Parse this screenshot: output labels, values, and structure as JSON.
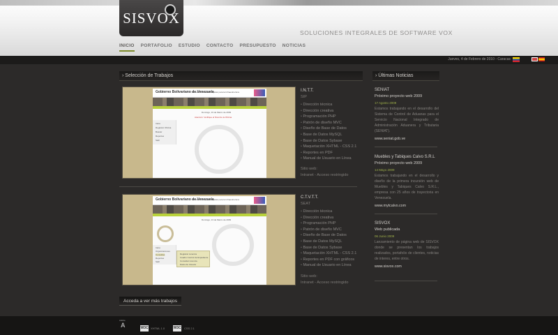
{
  "brand": {
    "logo": "SISVOX",
    "tagline": "SOLUCIONES INTEGRALES DE SOFTWARE VOX"
  },
  "nav": [
    {
      "label": "INICIO",
      "active": true
    },
    {
      "label": "PORTAFOLIO",
      "active": false
    },
    {
      "label": "ESTUDIO",
      "active": false
    },
    {
      "label": "CONTACTO",
      "active": false
    },
    {
      "label": "PRESUPUESTO",
      "active": false
    },
    {
      "label": "NOTICIAS",
      "active": false
    }
  ],
  "date_text": "Jueves, 4 de Febrero de 2010 - Caracas",
  "sections": {
    "works": "› Selección de Trabajos",
    "news": "› Últimas Noticias"
  },
  "projects": [
    {
      "title": "I.N.T.T.",
      "subtitle": "SIP",
      "features": [
        "Dirección técnica",
        "Dirección creativa",
        "Programación PHP",
        "Patrón de diseño MVC",
        "Diseño de Base de Datos",
        "Base de Datos MySQL",
        "Base de Datos Sybase",
        "Maquetación XHTML - CSS 2.1",
        "Reportes en PDF",
        "Manual de Usuario en Línea"
      ],
      "site_label": "Sitio web:",
      "site_value": "Intranet - Acceso restringido",
      "thumb": {
        "gob": "Gobierno Bolivariano de Venezuela",
        "ministry": "Ministerio del Poder Popular para la Infraestructura",
        "date": "Domingo, 19 de Marzo de 2009",
        "notice": "Atención: Verifique el Nivel de la Oficina",
        "menu": [
          "Inicio",
          "Registrar Oficina",
          "Buscar",
          "Reportes",
          "Salir"
        ]
      }
    },
    {
      "title": "C.T.V.T.T.",
      "subtitle": "SEAT",
      "features": [
        "Dirección técnica",
        "Dirección creativa",
        "Programación PHP",
        "Patrón de diseño MVC",
        "Diseño de Base de Datos",
        "Base de Datos MySQL",
        "Base de Datos Sybase",
        "Maquetación XHTML - CSS 2.1",
        "Reportes en PDF con gráficos",
        "Manual de Usuario en Línea"
      ],
      "site_label": "Sitio web:",
      "site_value": "Intranet - Acceso restringido",
      "thumb": {
        "gob": "Gobierno Bolivariano de Venezuela",
        "ministry": "Ministerio del Poder Popular para la Infraestructura",
        "date": "Domingo, 13 de Marzo de 2009",
        "menu": [
          "Inicio",
          "Organizaciones",
          "Consultas",
          "Reportes",
          "Salir"
        ],
        "submenu": [
          "Registrar Licencia",
          "Cuadro Control de Expediente",
          "Consultar Licencia",
          "Datos de Usuario"
        ]
      }
    }
  ],
  "more_button": "Acceda a ver más trabajos",
  "news": [
    {
      "org": "SENIAT",
      "headline": "Próximo proyecto web 2009",
      "date": "17 Agosto 2009",
      "body": "Estamos trabajando en el desarrollo del Sistema de Control de Aduanas para el Servicio Nacional Integrado de Administración Aduanera y Tributaria (SENIAT).",
      "link": "www.seniat.gob.ve"
    },
    {
      "org": "Muebles y Tabiques Calvo S.R.L",
      "headline": "Próximo proyecto web 2009",
      "date": "14 Mayo 2009",
      "body": "Estamos trabajando en el desarrollo y diseño de la primera incursión web de Muebles y Tabiques Calvo S.R.L., empresa con 25 años de trayectoria en Venezuela.",
      "link": "www.mytcalvo.com"
    },
    {
      "org": "SISVOX",
      "headline": "Web publicada",
      "date": "06 Junio 2009",
      "body": "Lanzamiento de página web de SISVOX donde se presentan los trabajos realizados, portafolio de clientes, noticias de interes, entre otros.",
      "link": "www.sisvox.com"
    }
  ],
  "footer": {
    "adobe_label": "Adobe",
    "badges": [
      {
        "badge": "W3C",
        "text": "XHTML 1.0"
      },
      {
        "badge": "W3C",
        "text": "CSS 2.1"
      }
    ]
  },
  "colors": {
    "background": "#2c2a29",
    "accent": "#7c8a2a",
    "date_green": "#9fb14a"
  },
  "icons": [
    "flag-venezuela-icon",
    "flag-english-icon",
    "flag-spanish-icon",
    "adobe-icon"
  ]
}
